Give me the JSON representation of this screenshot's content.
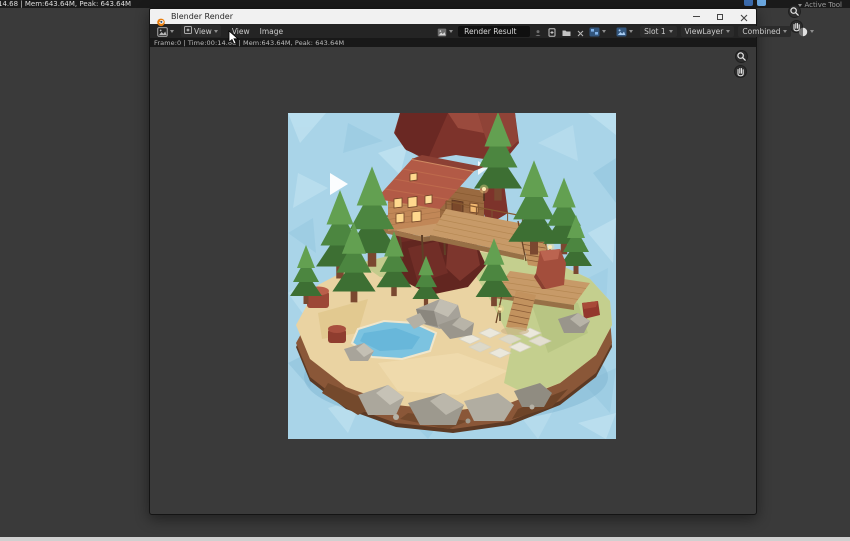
{
  "topbar": {
    "stats": "14.68 | Mem:643.64M, Peak: 643.64M",
    "active_tool": "Active Tool"
  },
  "window": {
    "title": "Blender Render",
    "header": {
      "mode": "View",
      "menu_view": "View",
      "menu_image": "Image",
      "image_name": "Render Result",
      "slot": "Slot 1",
      "layer": "ViewLayer",
      "pass": "Combined"
    },
    "info": "Frame:0 | Time:00:14.68 | Mem:643.64M, Peak: 643.64M"
  },
  "colors": {
    "blender_orange": "#e87d0d",
    "titlebar_bg": "#f1f1f1",
    "header_bg": "#242424",
    "info_bg": "#181818",
    "canvas_bg": "#3a3a3a",
    "top_strip_bg": "#1a1a1a",
    "footer_bar": "#d0d0d0",
    "slot_icon_blue": "#79aede",
    "render_sky_blue": "#a9d4e8"
  }
}
